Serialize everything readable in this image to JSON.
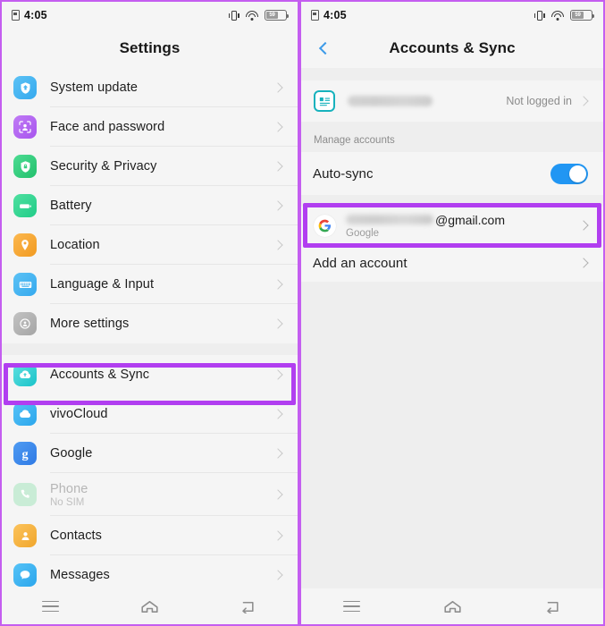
{
  "status_bar": {
    "time": "4:05",
    "battery_percent": "59",
    "icons": [
      "sim-card-icon",
      "vibrate-icon",
      "wifi-icon",
      "battery-icon"
    ]
  },
  "left_panel": {
    "title": "Settings",
    "items": [
      {
        "label": "System update",
        "icon": "shield-update-icon",
        "color": "#46b6f0"
      },
      {
        "label": "Face and password",
        "icon": "face-id-icon",
        "color": "#b565f0"
      },
      {
        "label": "Security & Privacy",
        "icon": "shield-lock-icon",
        "color": "#2ec978"
      },
      {
        "label": "Battery",
        "icon": "battery-icon",
        "color": "#2ed08a"
      },
      {
        "label": "Location",
        "icon": "location-pin-icon",
        "color": "#f5a52e"
      },
      {
        "label": "Language & Input",
        "icon": "keyboard-icon",
        "color": "#46b6f0"
      },
      {
        "label": "More settings",
        "icon": "more-settings-icon",
        "color": "#aeaeae"
      }
    ],
    "items_after_gap": [
      {
        "label": "Accounts & Sync",
        "icon": "cloud-sync-icon",
        "color": "#2ecfd4",
        "highlighted": true
      },
      {
        "label": "vivoCloud",
        "icon": "cloud-icon",
        "color": "#3fb4ef"
      },
      {
        "label": "Google",
        "icon": "google-g-icon",
        "color": "#3f8ded"
      },
      {
        "label": "Phone",
        "sublabel": "No SIM",
        "icon": "phone-icon",
        "color": "#b6e8c8",
        "disabled": true
      },
      {
        "label": "Contacts",
        "icon": "contacts-icon",
        "color": "#f5b43c"
      },
      {
        "label": "Messages",
        "icon": "messages-icon",
        "color": "#3fb4ef"
      }
    ]
  },
  "right_panel": {
    "title": "Accounts & Sync",
    "back_label": "Back",
    "vivo_account": {
      "name_redacted": "",
      "status": "Not logged in",
      "icon": "vivo-account-card-icon"
    },
    "section_header": "Manage accounts",
    "auto_sync": {
      "label": "Auto-sync",
      "enabled": true
    },
    "google_account": {
      "email_domain": "@gmail.com",
      "provider": "Google",
      "icon": "google-logo-icon",
      "highlighted": true
    },
    "add_account": {
      "label": "Add an account"
    }
  },
  "nav_bar": {
    "items": [
      "menu-icon",
      "home-icon",
      "back-icon"
    ]
  },
  "colors": {
    "highlight": "#b13ef0",
    "frame": "#c45ef0",
    "accent_blue": "#2196f3",
    "back_chevron": "#3d9ae8"
  }
}
